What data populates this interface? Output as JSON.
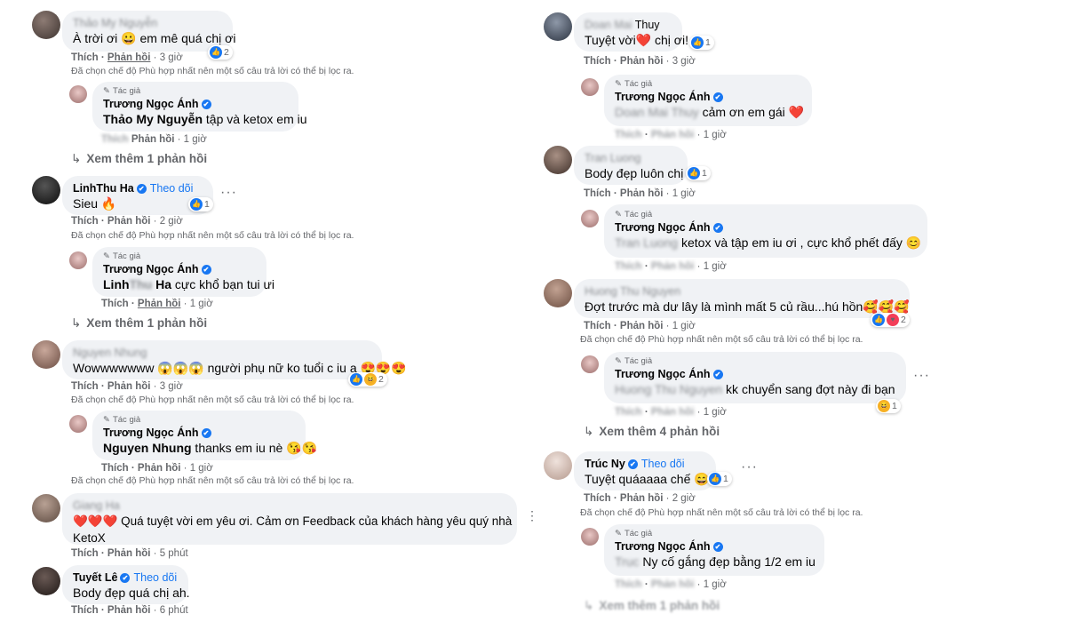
{
  "labels": {
    "like": "Thích",
    "reply": "Phản hồi",
    "author_tag": "Tác giả",
    "follow": "Theo dõi",
    "filter_notice": "Đã chọn chế độ Phù hợp nhất nên một số câu trả lời có thể bị lọc ra.",
    "page_author": "Trương Ngọc Ánh",
    "more_dots": "···"
  },
  "left": {
    "c1": {
      "author": "Thảo My Nguyễn",
      "text": "À trời ơi 😀 em mê quá chị ơi",
      "time": "· 3 giờ",
      "reactions": "2"
    },
    "c1_reply": {
      "text_bold": "Thảo My Nguyễn",
      "text": " tập và ketox em iu",
      "time": "· 1 giờ"
    },
    "c1_more": "Xem thêm 1 phản hồi",
    "c2": {
      "author": "LinhThu Ha",
      "text": "Sieu 🔥",
      "time": "· 2 giờ",
      "reactions": "1"
    },
    "c2_reply": {
      "text_bold_a": "Linh",
      "text_blur": "Thu",
      "text_bold_b": " Ha",
      "text": " cực khổ bạn tui ưi",
      "time": "· 1 giờ"
    },
    "c2_more": "Xem thêm 1 phản hồi",
    "c3": {
      "author": "Nguyen Nhung",
      "text": "Wowwwwwww 😱😱😱 người phụ nữ ko tuổi c iu ạ 😍😍😍",
      "time": "· 3 giờ",
      "reactions": "2"
    },
    "c3_reply": {
      "text_bold": "Nguyen Nhung",
      "text": " thanks em iu nè 😘😘",
      "time": "· 1 giờ"
    },
    "c4": {
      "author": "Giang Ha",
      "text_line1": "❤️❤️❤️ Quá tuyệt vời em yêu ơi. Cảm ơn Feedback của khách hàng yêu quý nhà",
      "text_line2": "KetoX",
      "time": "· 5 phút"
    },
    "c5": {
      "author": "Tuyết Lê",
      "text": "Body đẹp quá chị ah.",
      "time": "· 6 phút"
    }
  },
  "right": {
    "c1": {
      "author_blur": "Doan Mai",
      "author": " Thuy",
      "text": "Tuyệt vời❤️ chị ơi!",
      "time": "· 3 giờ",
      "reactions": "1"
    },
    "c1_reply": {
      "text_blur": "Doan Mai Thuy",
      "text": " cảm ơn em gái ❤️",
      "time": "· 1 giờ"
    },
    "c2": {
      "author": "Tran Luong",
      "text": "Body đẹp luôn chị",
      "time": "· 1 giờ",
      "reactions": "1"
    },
    "c2_reply": {
      "text_blur": "Tran Luong",
      "text": " ketox và tập em iu ơi , cực khổ phết đấy 😊",
      "time": "· 1 giờ"
    },
    "c3": {
      "author": "Huong Thu Nguyen",
      "text": "Đợt trước mà dư lây là mình mất 5 củ rầu...hú hồn🥰🥰🥰",
      "time": "· 1 giờ",
      "reactions": "2"
    },
    "c3_reply": {
      "text_blur": "Huong Thu Nguyen",
      "text": " kk chuyển sang đợt này đi bạn",
      "time": "· 1 giờ",
      "reactions": "1"
    },
    "c3_more": "Xem thêm 4 phản hồi",
    "c4": {
      "author": "Trúc Ny",
      "text": "Tuyệt quáaaaa chế 😄",
      "time": "· 2 giờ",
      "reactions": "1"
    },
    "c4_reply": {
      "text_blur": "Truc",
      "text_bold": " Ny",
      "text": " cố gắng đẹp bằng 1/2 em iu",
      "time": "· 1 giờ"
    },
    "c4_more": "Xem thêm 1 phản hồi"
  },
  "colors": {
    "brand_blue": "#1877f2",
    "bubble": "#f0f2f5",
    "meta_gray": "#65676b"
  }
}
